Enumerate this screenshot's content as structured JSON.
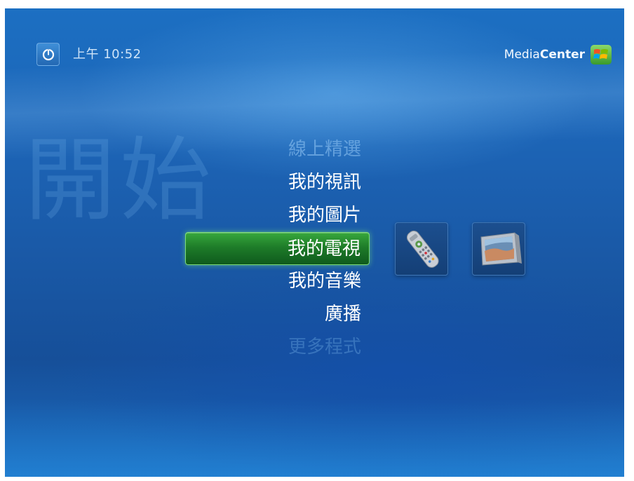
{
  "status_bar": {
    "time": "上午 10:52"
  },
  "brand": {
    "part1": "Media",
    "part2": "Center"
  },
  "watermark": "開始",
  "menu": {
    "items": [
      {
        "label": "線上精選",
        "state": "faded"
      },
      {
        "label": "我的視訊",
        "state": "normal"
      },
      {
        "label": "我的圖片",
        "state": "normal"
      },
      {
        "label": "我的電視",
        "state": "selected"
      },
      {
        "label": "我的音樂",
        "state": "normal"
      },
      {
        "label": "廣播",
        "state": "normal"
      },
      {
        "label": "更多程式",
        "state": "faded"
      }
    ]
  },
  "tiles": [
    {
      "icon": "remote-control-icon"
    },
    {
      "icon": "tv-monitor-icon"
    }
  ],
  "colors": {
    "background": "#1d66b8",
    "selection": "#1e7c29",
    "selection_border": "#7fdc78",
    "text": "#ffffff"
  }
}
